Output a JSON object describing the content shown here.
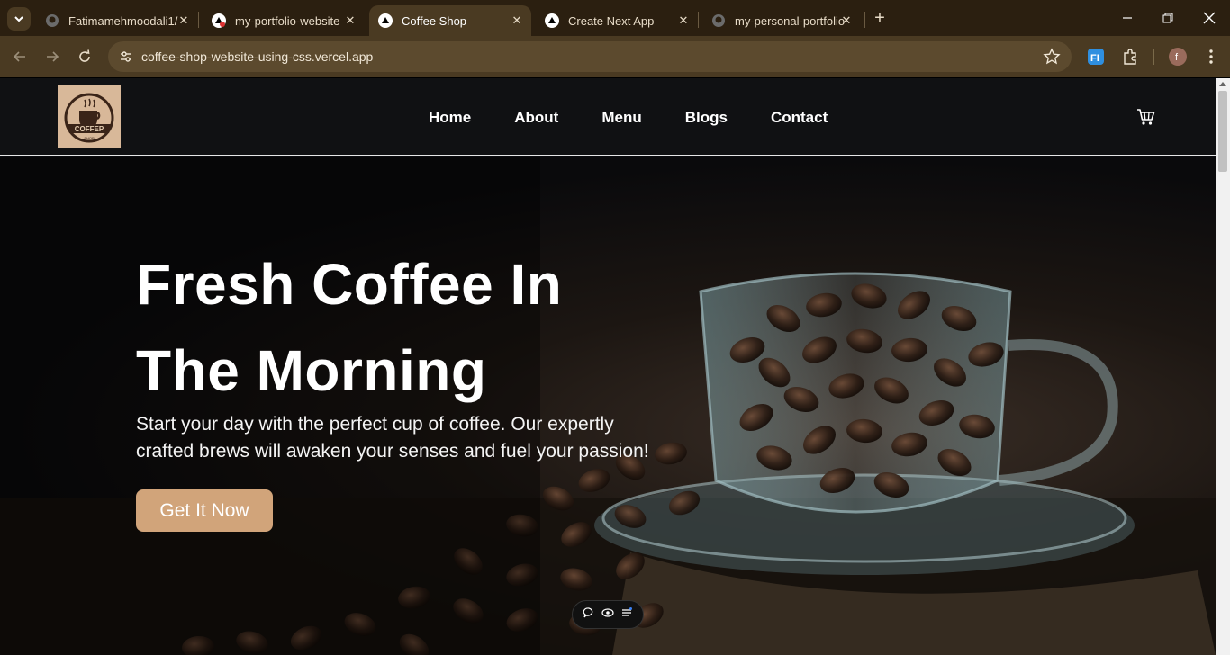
{
  "browser": {
    "tabs": [
      {
        "title": "Fatimamehmoodali1/",
        "icon": "github-icon",
        "active": false
      },
      {
        "title": "my-portfolio-website",
        "icon": "vercel-icon",
        "active": false
      },
      {
        "title": "Coffee Shop",
        "icon": "vercel-icon",
        "active": true
      },
      {
        "title": "Create Next App",
        "icon": "vercel-icon",
        "active": false
      },
      {
        "title": "my-personal-portfolio",
        "icon": "github-icon",
        "active": false
      }
    ],
    "new_tab": "+",
    "url": "coffee-shop-website-using-css.vercel.app",
    "profile_initial": "f",
    "colors": {
      "tabbar": "#2b1f10",
      "toolbar": "#4a3a22",
      "omnibox": "#5c4a2e"
    }
  },
  "site": {
    "logo": {
      "text_top": "COFFEP",
      "text_bottom": "SHOP"
    },
    "nav": [
      "Home",
      "About",
      "Menu",
      "Blogs",
      "Contact"
    ],
    "hero": {
      "title_line1": "Fresh Coffee In",
      "title_line2": "The Morning",
      "subtitle": "Start your day with the perfect cup of coffee. Our expertly crafted brews will awaken your senses and fuel your passion!",
      "cta": "Get It Now"
    },
    "colors": {
      "accent": "#d1a47a",
      "header_bg": "#101113"
    }
  }
}
